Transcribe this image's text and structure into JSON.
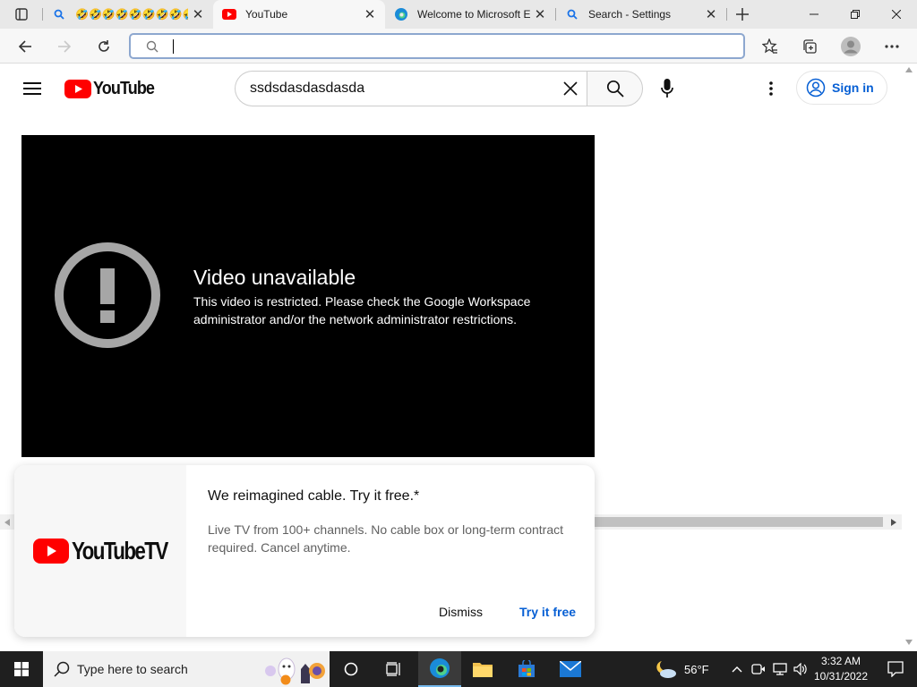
{
  "browser": {
    "tabs": [
      {
        "title": "🤣🤣🤣🤣🤣🤣🤣🤣🤣🤣",
        "icon": "search-icon"
      },
      {
        "title": "YouTube",
        "icon": "youtube-icon"
      },
      {
        "title": "Welcome to Microsoft Edge",
        "icon": "edge-icon"
      },
      {
        "title": "Search - Settings",
        "icon": "search-icon"
      }
    ],
    "address_value": ""
  },
  "youtube": {
    "logo_text": "YouTube",
    "search_value": "ssdsdasdasdasda",
    "signin_label": "Sign in",
    "player": {
      "error_title": "Video unavailable",
      "error_message": "This video is restricted. Please check the Google Workspace administrator and/or the network administrator restrictions."
    },
    "promo": {
      "logo_text": "YouTubeTV",
      "title": "We reimagined cable. Try it free.*",
      "body": "Live TV from 100+ channels. No cable box or long-term contract required. Cancel anytime.",
      "dismiss_label": "Dismiss",
      "try_label": "Try it free"
    }
  },
  "taskbar": {
    "search_placeholder": "Type here to search",
    "weather": "56°F",
    "time": "3:32 AM",
    "date": "10/31/2022"
  },
  "colors": {
    "youtube_red": "#ff0000",
    "link_blue": "#065fd4",
    "taskbar_bg": "#1f1f1f"
  }
}
